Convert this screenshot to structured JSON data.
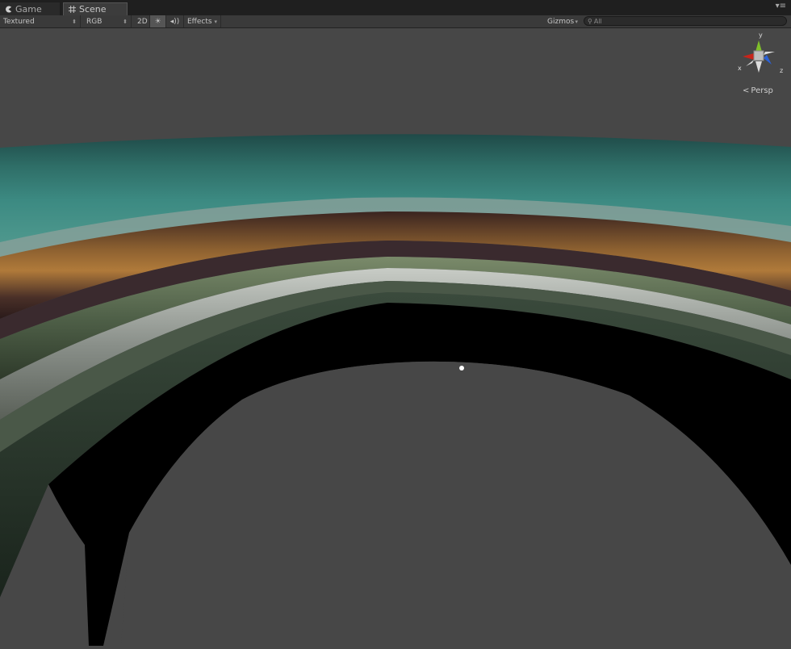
{
  "tabs": [
    {
      "label": "Game",
      "icon": "pacman-icon"
    },
    {
      "label": "Scene",
      "icon": "grid-icon"
    }
  ],
  "toolbar": {
    "render_mode": "Textured",
    "color_mode": "RGB",
    "mode_2d": "2D",
    "effects": "Effects",
    "gizmos": "Gizmos",
    "search_placeholder": "All"
  },
  "gizmo": {
    "x": "x",
    "y": "y",
    "z": "z",
    "projection": "Persp"
  },
  "colors": {
    "background": "#474747",
    "x_axis": "#c8241a",
    "y_axis": "#7fbf2a",
    "z_axis": "#2b62d8"
  }
}
